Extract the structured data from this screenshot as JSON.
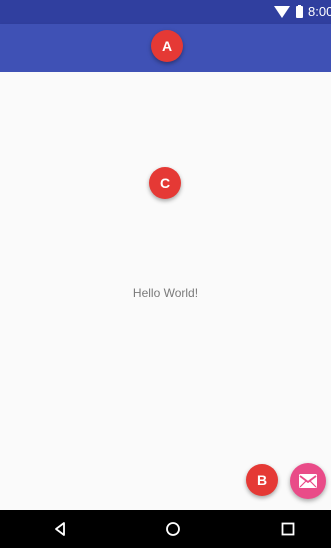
{
  "status_bar": {
    "time": "8:00",
    "icons": [
      "wifi-icon",
      "battery-icon"
    ]
  },
  "app_bar": {
    "color": "#3f51b5"
  },
  "markers": {
    "a": "A",
    "b": "B",
    "c": "C",
    "color": "#e53935"
  },
  "content": {
    "message": "Hello World!"
  },
  "fab": {
    "icon": "mail-icon",
    "color": "#e94b88"
  },
  "navigation": {
    "back_icon": "back-icon",
    "home_icon": "home-icon",
    "recent_icon": "recent-apps-icon"
  }
}
